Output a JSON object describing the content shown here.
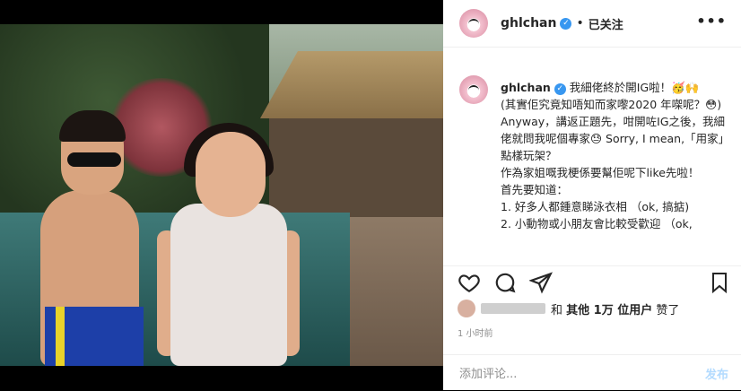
{
  "post": {
    "username": "ghlchan",
    "follow_separator": "•",
    "follow_status": "已关注",
    "more_glyph": "•••",
    "caption_username": "ghlchan",
    "caption_text": "我細佬終於開IG啦！🥳🙌\n(其實佢究竟知唔知而家嚟2020 年㗎呢？😳)\nAnyway，講返正題先，咁開咗IG之後，我細佬就問我呢個專家😓 Sorry, I mean,「用家」點樣玩架？\n作為家姐嘅我梗係要幫佢呢下like先啦！\n首先要知道：\n1. 好多人都鍾意睇泳衣相 （ok, 搞掂)\n2. 小動物或小朋友會比較受歡迎 （ok,",
    "likes_prefix": "和",
    "likes_others": "其他 1万 位用户",
    "likes_suffix": "赞了",
    "time_ago": "1 小时前",
    "comment_placeholder": "添加评论...",
    "post_button": "发布"
  },
  "icons": [
    "verified-icon",
    "more-icon",
    "heart-icon",
    "comment-icon",
    "share-icon",
    "bookmark-icon"
  ],
  "colors": {
    "verified": "#3897f0",
    "post_button": "#b3dbff",
    "muted": "#8e8e8e"
  }
}
